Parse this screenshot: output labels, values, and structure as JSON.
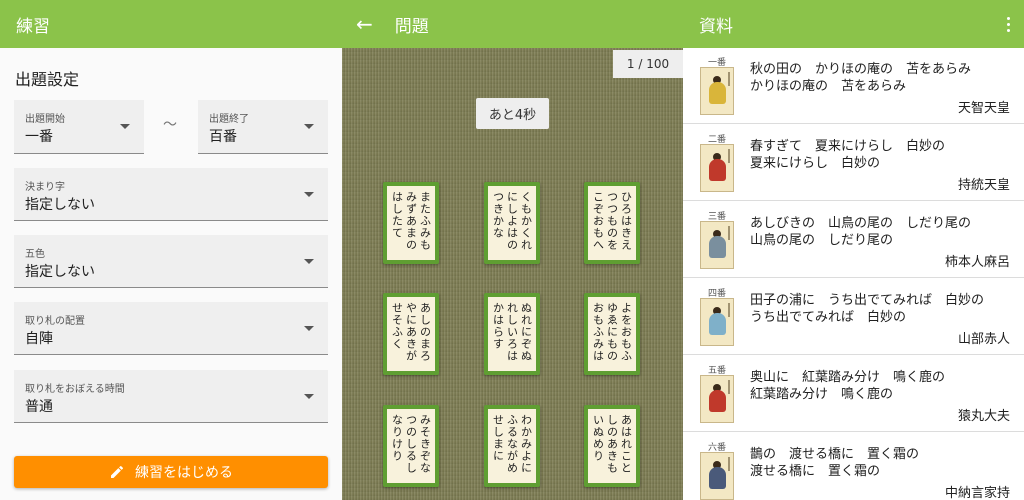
{
  "practice": {
    "title": "練習",
    "section_title": "出題設定",
    "range_start": {
      "label": "出題開始",
      "value": "一番"
    },
    "tilde": "～",
    "range_end": {
      "label": "出題終了",
      "value": "百番"
    },
    "kimariji": {
      "label": "決まり字",
      "value": "指定しない"
    },
    "goshiki": {
      "label": "五色",
      "value": "指定しない"
    },
    "layout": {
      "label": "取り札の配置",
      "value": "自陣"
    },
    "memorize_time": {
      "label": "取り札をおぼえる時間",
      "value": "普通"
    },
    "start_button": "練習をはじめる"
  },
  "question": {
    "title": "問題",
    "counter": "1 / 100",
    "timer": "あと4秒",
    "cards": [
      {
        "cols": [
          "またふみも",
          "みずあまの",
          "はしたて"
        ]
      },
      {
        "cols": [
          "くもかくれ",
          "にしよはの",
          "つきかな"
        ]
      },
      {
        "cols": [
          "ひろはきえ",
          "つつものを",
          "こぞおもへ"
        ]
      },
      {
        "cols": [
          "あしのまろ",
          "やにあきが",
          "せそふく"
        ]
      },
      {
        "cols": [
          "ぬれにぞぬ",
          "れしいろは",
          "かはらす"
        ]
      },
      {
        "cols": [
          "よをおもふ",
          "ゆゑにもの",
          "おもふみは"
        ]
      },
      {
        "cols": [
          "みそきぞな",
          "つのしるし",
          "なりけり"
        ]
      },
      {
        "cols": [
          "わかみよに",
          "ふるながめ",
          "せしまに"
        ]
      },
      {
        "cols": [
          "あはれこと",
          "しのあきも",
          "いぬめり"
        ]
      }
    ]
  },
  "materials": {
    "title": "資料",
    "poems": [
      {
        "num": "一番",
        "line1": "秋の田の　かりほの庵の　苫をあらみ",
        "line2": "かりほの庵の　苫をあらみ",
        "author": "天智天皇",
        "color": "#d9b53a"
      },
      {
        "num": "二番",
        "line1": "春すぎて　夏来にけらし　白妙の",
        "line2": "夏来にけらし　白妙の",
        "author": "持統天皇",
        "color": "#c0392b"
      },
      {
        "num": "三番",
        "line1": "あしびきの　山鳥の尾の　しだり尾の",
        "line2": "山鳥の尾の　しだり尾の",
        "author": "柿本人麻呂",
        "color": "#7a8f9e"
      },
      {
        "num": "四番",
        "line1": "田子の浦に　うち出でてみれば　白妙の",
        "line2": "うち出でてみれば　白妙の",
        "author": "山部赤人",
        "color": "#7fb0c9"
      },
      {
        "num": "五番",
        "line1": "奥山に　紅葉踏み分け　鳴く鹿の",
        "line2": "紅葉踏み分け　鳴く鹿の",
        "author": "猿丸大夫",
        "color": "#c0392b"
      },
      {
        "num": "六番",
        "line1": "鵲の　渡せる橋に　置く霜の",
        "line2": "渡せる橋に　置く霜の",
        "author": "中納言家持",
        "color": "#4a5a7a"
      }
    ]
  }
}
